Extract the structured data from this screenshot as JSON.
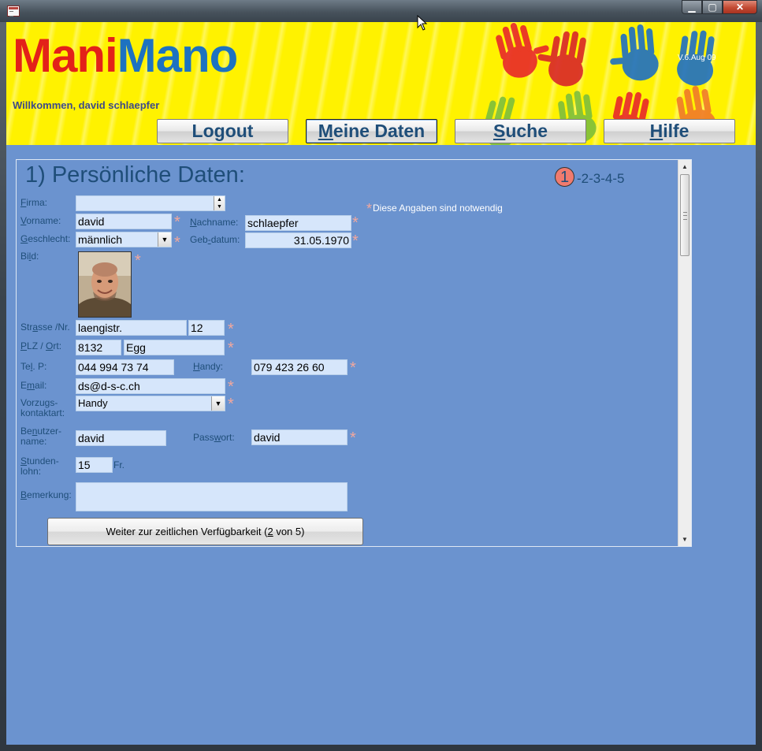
{
  "header": {
    "logo_part1": "Mani",
    "logo_part2": "Mano",
    "welcome": "Willkommen, david schlaepfer",
    "version": "V.6.Aug 09"
  },
  "nav": {
    "logout": "Logout",
    "meine_daten_prefix": "",
    "meine_daten_u": "M",
    "meine_daten_rest": "eine Daten",
    "suche_u": "S",
    "suche_rest": "uche",
    "hilfe_u": "H",
    "hilfe_rest": "ilfe"
  },
  "form": {
    "title": "1) Persönliche Daten:",
    "step_current": "1",
    "step_rest": "-2-3-4-5",
    "required_note": "Diese Angaben sind notwendig",
    "labels": {
      "firma_u": "F",
      "firma_rest": "irma:",
      "vorname_u": "V",
      "vorname_rest": "orname:",
      "geschlecht_u": "G",
      "geschlecht_rest": "eschlecht:",
      "bild_pre": "Bi",
      "bild_u": "l",
      "bild_rest": "d:",
      "strasse_pre": "Str",
      "strasse_u": "a",
      "strasse_rest": "sse /Nr.",
      "plz_u": "P",
      "plz_rest": "LZ / ",
      "ort_u": "O",
      "ort_rest": "rt:",
      "tel_pre": "Te",
      "tel_u": "l",
      "tel_rest": ". P:",
      "email_pre": "E",
      "email_u": "m",
      "email_rest": "ail:",
      "vorzug_1": "Vorzugs-",
      "vorzug_2": "kontaktart:",
      "benutzer_pre": "Be",
      "benutzer_u": "n",
      "benutzer_rest": "utzer-",
      "benutzer_2": "name:",
      "stunden_u": "S",
      "stunden_rest": "tunden-",
      "stunden_2": "lohn:",
      "bemerkung_u": "B",
      "bemerkung_rest": "emerkung:",
      "nachname_u": "N",
      "nachname_rest": "achname:",
      "geb_pre": "Geb",
      "geb_u": "-",
      "geb_rest": "datum:",
      "handy_u": "H",
      "handy_rest": "andy:",
      "passwort_pre": "Pass",
      "passwort_u": "w",
      "passwort_rest": "ort:",
      "currency": "Fr."
    },
    "values": {
      "firma": "",
      "vorname": "david",
      "nachname": "schlaepfer",
      "geschlecht": "männlich",
      "geburtsdatum": "31.05.1970",
      "strasse": "laengistr.",
      "nr": "12",
      "plz": "8132",
      "ort": "Egg",
      "tel_p": "044 994 73 74",
      "handy": "079 423 26 60",
      "email": "ds@d-s-c.ch",
      "vorzugs_kontaktart": "Handy",
      "benutzername": "david",
      "passwort": "david",
      "stundenlohn": "15",
      "bemerkung": ""
    },
    "next_button_pre": "Weiter zur zeitlichen Verfügbarkeit (",
    "next_button_u": "2",
    "next_button_post": " von 5)"
  },
  "icons": {
    "app": "form-icon",
    "minimize": "minimize-icon",
    "maximize": "maximize-icon",
    "close": "close-icon",
    "combo": "chevron-down-icon",
    "required": "asterisk-icon"
  },
  "colors": {
    "background": "#6b93cf",
    "header": "#fff200",
    "mani": "#e32119",
    "mano": "#1d72c0",
    "label": "#1f4e79",
    "field": "#d6e6fb",
    "required": "#f2a79d"
  }
}
